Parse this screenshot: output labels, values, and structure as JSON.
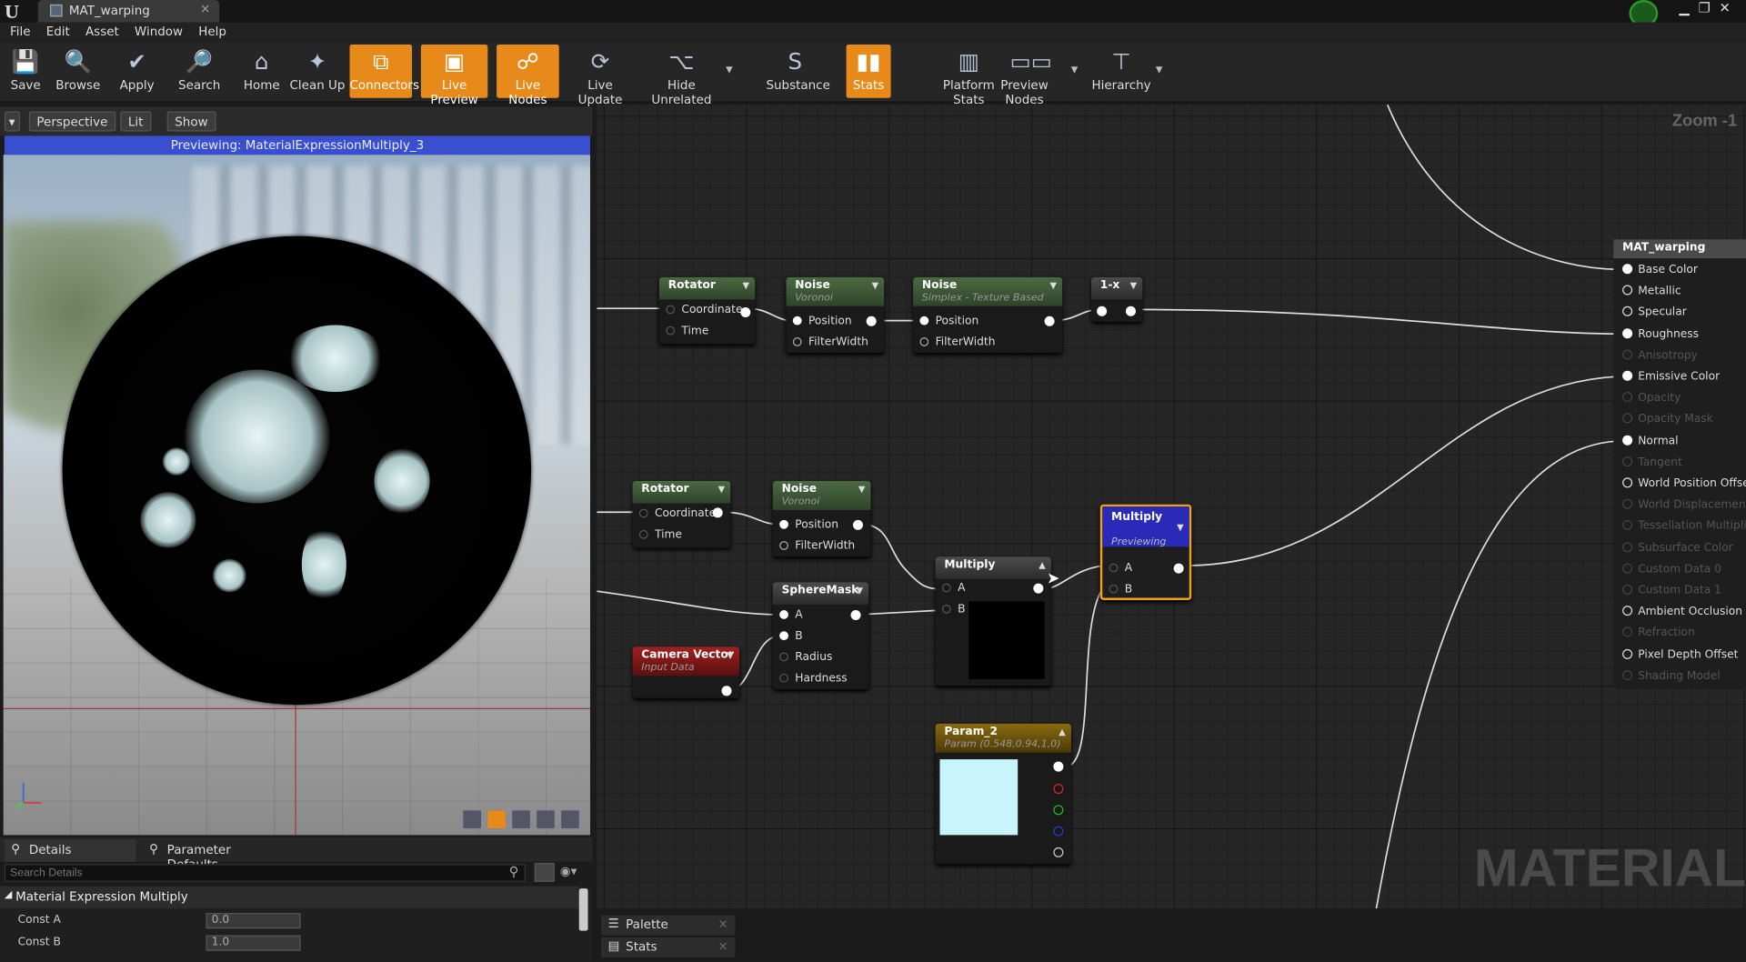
{
  "window": {
    "tab_title": "MAT_warping",
    "logo": "U"
  },
  "menu": [
    "File",
    "Edit",
    "Asset",
    "Window",
    "Help"
  ],
  "toolbar": [
    {
      "label": "Save",
      "icon": "save-icon",
      "active": false
    },
    {
      "label": "Browse",
      "icon": "browse-icon",
      "active": false
    },
    {
      "label": "Apply",
      "icon": "apply-icon",
      "active": false
    },
    {
      "label": "Search",
      "icon": "search-icon",
      "active": false
    },
    {
      "label": "Home",
      "icon": "home-icon",
      "active": false
    },
    {
      "label": "Clean Up",
      "icon": "cleanup-icon",
      "active": false
    },
    {
      "label": "Connectors",
      "icon": "connectors-icon",
      "active": true
    },
    {
      "label": "Live Preview",
      "icon": "live-preview-icon",
      "active": true
    },
    {
      "label": "Live Nodes",
      "icon": "live-nodes-icon",
      "active": true
    },
    {
      "label": "Live Update",
      "icon": "live-update-icon",
      "active": false
    },
    {
      "label": "Hide Unrelated",
      "icon": "hide-unrelated-icon",
      "active": false
    },
    {
      "label": "Substance",
      "icon": "substance-icon",
      "active": false
    },
    {
      "label": "Stats",
      "icon": "stats-icon",
      "active": true
    },
    {
      "label": "Platform Stats",
      "icon": "platform-stats-icon",
      "active": false
    },
    {
      "label": "Preview Nodes",
      "icon": "preview-nodes-icon",
      "active": false
    },
    {
      "label": "Hierarchy",
      "icon": "hierarchy-icon",
      "active": false
    }
  ],
  "viewport": {
    "perspective": "Perspective",
    "lit": "Lit",
    "show": "Show",
    "header": "Previewing: MaterialExpressionMultiply_3"
  },
  "details": {
    "tab_details": "Details",
    "tab_params": "Parameter Defaults",
    "search_placeholder": "Search Details",
    "category": "Material Expression Multiply",
    "const_a_label": "Const A",
    "const_a_value": "0.0",
    "const_b_label": "Const B",
    "const_b_value": "1.0"
  },
  "graph": {
    "zoom": "Zoom -1",
    "watermark": "MATERIAL",
    "rotator1": {
      "title": "Rotator",
      "pins": [
        "Coordinate",
        "Time"
      ]
    },
    "noise1": {
      "title": "Noise",
      "subtitle": "Voronoi",
      "pins": [
        "Position",
        "FilterWidth"
      ]
    },
    "noise2": {
      "title": "Noise",
      "subtitle": "Simplex - Texture Based",
      "pins": [
        "Position",
        "FilterWidth"
      ]
    },
    "oneminus": {
      "title": "1-x"
    },
    "rotator2": {
      "title": "Rotator",
      "pins": [
        "Coordinate",
        "Time"
      ]
    },
    "noise3": {
      "title": "Noise",
      "subtitle": "Voronoi",
      "pins": [
        "Position",
        "FilterWidth"
      ]
    },
    "spheremask": {
      "title": "SphereMask",
      "pins": [
        "A",
        "B",
        "Radius",
        "Hardness"
      ]
    },
    "camvec": {
      "title": "Camera Vector",
      "subtitle": "Input Data"
    },
    "multiply1": {
      "title": "Multiply",
      "pins": [
        "A",
        "B"
      ]
    },
    "multiply2": {
      "title": "Multiply",
      "subtitle": "Previewing",
      "pins": [
        "A",
        "B"
      ]
    },
    "param2": {
      "title": "Param_2",
      "subtitle": "Param (0.548,0.94,1,0)",
      "color": "#c8f4fc"
    },
    "result": {
      "title": "MAT_warping",
      "pins": [
        {
          "label": "Base Color",
          "state": "on"
        },
        {
          "label": "Metallic",
          "state": "hollow"
        },
        {
          "label": "Specular",
          "state": "hollow"
        },
        {
          "label": "Roughness",
          "state": "on"
        },
        {
          "label": "Anisotropy",
          "state": "dim"
        },
        {
          "label": "Emissive Color",
          "state": "on"
        },
        {
          "label": "Opacity",
          "state": "dim"
        },
        {
          "label": "Opacity Mask",
          "state": "dim"
        },
        {
          "label": "Normal",
          "state": "on"
        },
        {
          "label": "Tangent",
          "state": "dim"
        },
        {
          "label": "World Position Offset",
          "state": "hollow"
        },
        {
          "label": "World Displacement",
          "state": "dim"
        },
        {
          "label": "Tessellation Multiplier",
          "state": "dim"
        },
        {
          "label": "Subsurface Color",
          "state": "dim"
        },
        {
          "label": "Custom Data 0",
          "state": "dim"
        },
        {
          "label": "Custom Data 1",
          "state": "dim"
        },
        {
          "label": "Ambient Occlusion",
          "state": "hollow"
        },
        {
          "label": "Refraction",
          "state": "dim"
        },
        {
          "label": "Pixel Depth Offset",
          "state": "hollow"
        },
        {
          "label": "Shading Model",
          "state": "dim"
        }
      ]
    }
  },
  "bottom_tabs": {
    "palette": "Palette",
    "stats": "Stats"
  }
}
